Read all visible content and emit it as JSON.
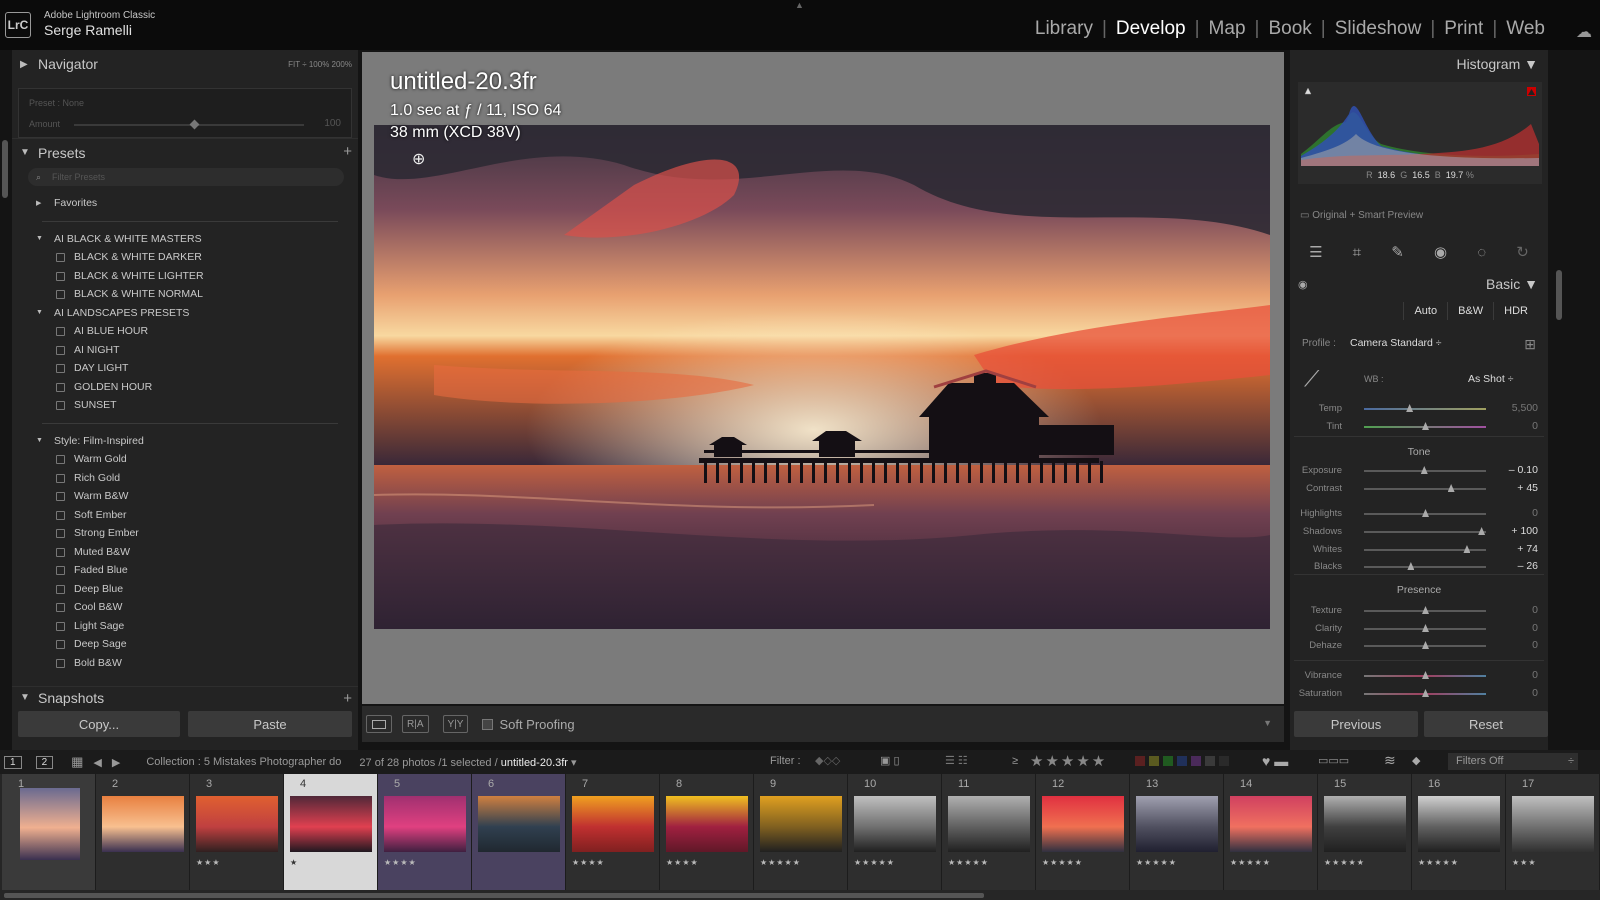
{
  "app": {
    "name": "Adobe Lightroom Classic",
    "user": "Serge Ramelli",
    "logo": "LrC"
  },
  "modules": [
    "Library",
    "Develop",
    "Map",
    "Book",
    "Slideshow",
    "Print",
    "Web"
  ],
  "active_module": "Develop",
  "navigator": {
    "title": "Navigator",
    "zoom_options": "FIT ÷   100%   200%",
    "preset_label": "Preset : None",
    "amount_label": "Amount",
    "amount_value": "100"
  },
  "presets": {
    "title": "Presets",
    "search_placeholder": "Filter Presets",
    "groups": [
      {
        "name": "Favorites",
        "collapsed": true,
        "items": []
      },
      {
        "name": "AI BLACK & WHITE MASTERS",
        "items": [
          "BLACK & WHITE DARKER",
          "BLACK & WHITE LIGHTER",
          "BLACK & WHITE NORMAL"
        ]
      },
      {
        "name": "AI LANDSCAPES PRESETS",
        "items": [
          "AI BLUE HOUR",
          "AI NIGHT",
          "DAY LIGHT",
          "GOLDEN HOUR",
          "SUNSET"
        ]
      },
      {
        "name": "Style: Film-Inspired",
        "items": [
          "Warm Gold",
          "Rich Gold",
          "Warm B&W",
          "Soft Ember",
          "Strong Ember",
          "Muted B&W",
          "Faded Blue",
          "Deep Blue",
          "Cool B&W",
          "Light Sage",
          "Deep Sage",
          "Bold B&W"
        ]
      }
    ]
  },
  "snapshots": {
    "title": "Snapshots"
  },
  "left_buttons": {
    "copy": "Copy...",
    "paste": "Paste"
  },
  "image": {
    "title": "untitled-20.3fr",
    "exposure_info": "1.0 sec at ƒ / 11, ISO 64",
    "lens_info": "38 mm (XCD 38V)"
  },
  "toolbar": {
    "view1": "",
    "view2": "R|A",
    "view3": "Y|Y",
    "soft_proofing": "Soft Proofing"
  },
  "histogram": {
    "title": "Histogram",
    "r_label": "R",
    "r": "18.6",
    "g_label": "G",
    "g": "16.5",
    "b_label": "B",
    "b": "19.7",
    "pct": "%",
    "preview": "Original + Smart Preview"
  },
  "basic": {
    "title": "Basic",
    "treatment": [
      "Auto",
      "B&W",
      "HDR"
    ],
    "profile_label": "Profile :",
    "profile": "Camera Standard",
    "wb_label": "WB :",
    "wb": "As Shot",
    "tone_label": "Tone",
    "presence_label": "Presence",
    "sliders": [
      {
        "label": "Temp",
        "value": "5,500",
        "pos": 0.37,
        "dim": true
      },
      {
        "label": "Tint",
        "value": "0",
        "pos": 0.5,
        "dim": true
      },
      {
        "label": "Exposure",
        "value": "– 0.10",
        "pos": 0.49
      },
      {
        "label": "Contrast",
        "value": "+ 45",
        "pos": 0.71
      },
      {
        "label": "Highlights",
        "value": "0",
        "pos": 0.5,
        "dim": true
      },
      {
        "label": "Shadows",
        "value": "+ 100",
        "pos": 0.96
      },
      {
        "label": "Whites",
        "value": "+ 74",
        "pos": 0.84
      },
      {
        "label": "Blacks",
        "value": "– 26",
        "pos": 0.38
      },
      {
        "label": "Texture",
        "value": "0",
        "pos": 0.5,
        "dim": true
      },
      {
        "label": "Clarity",
        "value": "0",
        "pos": 0.5,
        "dim": true
      },
      {
        "label": "Dehaze",
        "value": "0",
        "pos": 0.5,
        "dim": true
      },
      {
        "label": "Vibrance",
        "value": "0",
        "pos": 0.5,
        "dim": true
      },
      {
        "label": "Saturation",
        "value": "0",
        "pos": 0.5,
        "dim": true
      }
    ]
  },
  "right_buttons": {
    "previous": "Previous",
    "reset": "Reset"
  },
  "filmstrip_bar": {
    "page1": "1",
    "page2": "2",
    "collection": "Collection : 5 Mistakes Photographer do",
    "count": "27 of 28 photos /1 selected /",
    "selected_file": "untitled-20.3fr",
    "filter_label": "Filter :",
    "filters_off": "Filters Off",
    "ge": "≥"
  },
  "filmstrip": [
    {
      "num": "1",
      "stars": "",
      "selected": true
    },
    {
      "num": "2",
      "stars": ""
    },
    {
      "num": "3",
      "stars": "★★★"
    },
    {
      "num": "4",
      "stars": "★",
      "current": true
    },
    {
      "num": "5",
      "stars": "★★★★"
    },
    {
      "num": "6",
      "stars": ""
    },
    {
      "num": "7",
      "stars": "★★★★"
    },
    {
      "num": "8",
      "stars": "★★★★"
    },
    {
      "num": "9",
      "stars": "★★★★★"
    },
    {
      "num": "10",
      "stars": "★★★★★"
    },
    {
      "num": "11",
      "stars": "★★★★★"
    },
    {
      "num": "12",
      "stars": "★★★★★"
    },
    {
      "num": "13",
      "stars": "★★★★★"
    },
    {
      "num": "14",
      "stars": "★★★★★"
    },
    {
      "num": "15",
      "stars": "★★★★★"
    },
    {
      "num": "16",
      "stars": "★★★★★"
    },
    {
      "num": "17",
      "stars": "★★★"
    }
  ],
  "colors": {
    "bg": "#141414",
    "panel": "#232323",
    "center": "#7b7b7b",
    "active_text": "#ffffff"
  }
}
